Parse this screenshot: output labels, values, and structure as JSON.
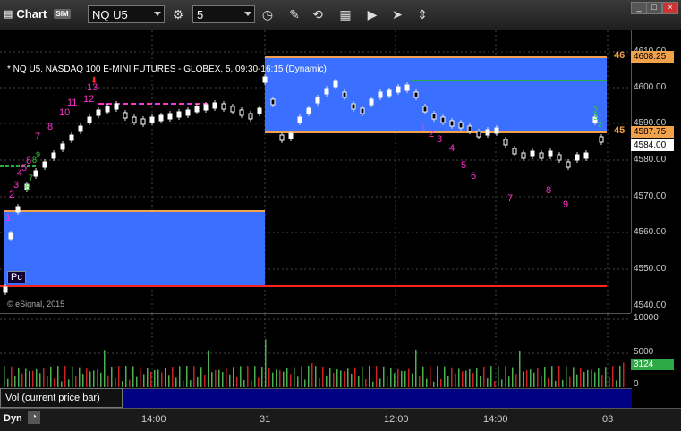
{
  "app": {
    "title": "Chart",
    "badge": "SIM"
  },
  "toolbar": {
    "symbol": "NQ U5",
    "interval": "5"
  },
  "chart": {
    "title": "* NQ U5, NASDAQ 100 E-MINI FUTURES - GLOBEX, 5, 09:30-16:15 (Dynamic)",
    "copyright": "© eSignal, 2015",
    "pc_label": "Pc",
    "price_axis": [
      "4610.00",
      "4600.00",
      "4590.00",
      "4580.00",
      "4570.00",
      "4560.00",
      "4550.00",
      "4540.00"
    ],
    "price_tags": [
      {
        "text": "4608.25",
        "bg": "#f2a24a",
        "fg": "#000"
      },
      {
        "text": "4587.75",
        "bg": "#f2a24a",
        "fg": "#000"
      },
      {
        "text": "4584.00",
        "bg": "#ffffff",
        "fg": "#000"
      }
    ],
    "left_tags": [
      "46",
      "45"
    ],
    "annotations_magenta": [
      "13",
      "12",
      "11",
      "10",
      "8",
      "7",
      "6",
      "5",
      "4",
      "3",
      "2",
      "1",
      "1",
      "2",
      "3",
      "4",
      "5",
      "6",
      "7",
      "8",
      "9"
    ],
    "annotations_green": [
      "9",
      "8",
      "7",
      "6",
      "2",
      "3",
      "2"
    ]
  },
  "volume": {
    "label": "Vol (current price bar)",
    "axis": [
      "10000",
      "5000",
      "0"
    ],
    "tag": "3124"
  },
  "time_axis": {
    "dyn": "Dyn",
    "labels": [
      "14:00",
      "31",
      "12:00",
      "14:00",
      "03"
    ]
  }
}
